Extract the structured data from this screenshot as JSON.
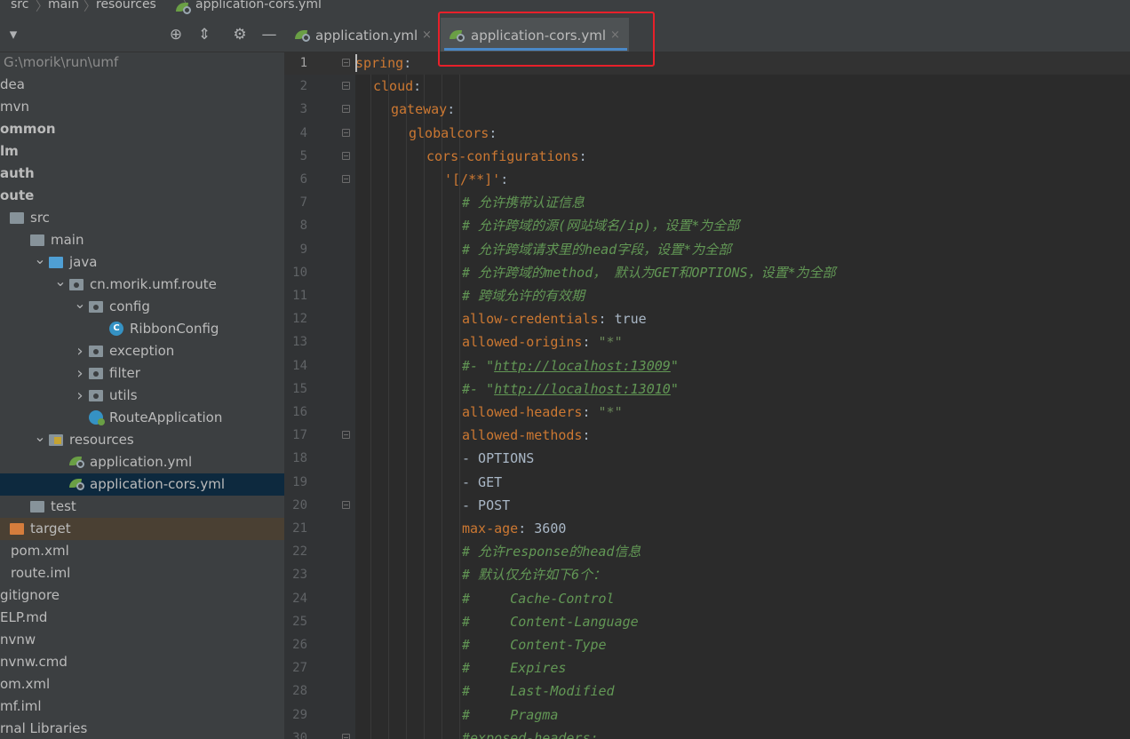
{
  "breadcrumb": [
    "src",
    "main",
    "resources",
    "application-cors.yml"
  ],
  "sidebar": {
    "toolbar": [
      "dropdown-icon",
      "locate-icon",
      "collapse-icon",
      "gear-icon",
      "minimize-icon"
    ],
    "tree": [
      {
        "label": "G:\\morik\\run\\umf",
        "indent": 4,
        "icon": "none",
        "arrow": "none",
        "style": "path"
      },
      {
        "label": "dea",
        "indent": 0,
        "icon": "none",
        "arrow": "none"
      },
      {
        "label": "mvn",
        "indent": 0,
        "icon": "none",
        "arrow": "none"
      },
      {
        "label": "ommon",
        "indent": 0,
        "icon": "none",
        "arrow": "none",
        "bold": true
      },
      {
        "label": "lm",
        "indent": 0,
        "icon": "none",
        "arrow": "none",
        "bold": true
      },
      {
        "label": "auth",
        "indent": 0,
        "icon": "none",
        "arrow": "none",
        "bold": true
      },
      {
        "label": "oute",
        "indent": 0,
        "icon": "none",
        "arrow": "none",
        "bold": true
      },
      {
        "label": "src",
        "indent": 12,
        "icon": "folder",
        "arrow": "none"
      },
      {
        "label": "main",
        "indent": 35,
        "icon": "folder",
        "arrow": "none"
      },
      {
        "label": "java",
        "indent": 56,
        "icon": "folder-blue",
        "arrow": "down"
      },
      {
        "label": "cn.morik.umf.route",
        "indent": 79,
        "icon": "folder-pkg",
        "arrow": "down"
      },
      {
        "label": "config",
        "indent": 101,
        "icon": "folder-pkg",
        "arrow": "down"
      },
      {
        "label": "RibbonConfig",
        "indent": 124,
        "icon": "class-c",
        "arrow": "none"
      },
      {
        "label": "exception",
        "indent": 101,
        "icon": "folder-pkg",
        "arrow": "right"
      },
      {
        "label": "filter",
        "indent": 101,
        "icon": "folder-pkg",
        "arrow": "right"
      },
      {
        "label": "utils",
        "indent": 101,
        "icon": "folder-pkg",
        "arrow": "right"
      },
      {
        "label": "RouteApplication",
        "indent": 101,
        "icon": "app-run",
        "arrow": "none"
      },
      {
        "label": "resources",
        "indent": 56,
        "icon": "folder-res",
        "arrow": "down"
      },
      {
        "label": "application.yml",
        "indent": 79,
        "icon": "spring",
        "arrow": "none"
      },
      {
        "label": "application-cors.yml",
        "indent": 79,
        "icon": "spring",
        "arrow": "none",
        "selected": true
      },
      {
        "label": "test",
        "indent": 35,
        "icon": "folder",
        "arrow": "none"
      },
      {
        "label": "target",
        "indent": 12,
        "icon": "folder-orange",
        "arrow": "none",
        "target": true
      },
      {
        "label": "pom.xml",
        "indent": 12,
        "icon": "none",
        "arrow": "none"
      },
      {
        "label": "route.iml",
        "indent": 12,
        "icon": "none",
        "arrow": "none"
      },
      {
        "label": "gitignore",
        "indent": 0,
        "icon": "none",
        "arrow": "none"
      },
      {
        "label": "ELP.md",
        "indent": 0,
        "icon": "none",
        "arrow": "none"
      },
      {
        "label": "nvnw",
        "indent": 0,
        "icon": "none",
        "arrow": "none"
      },
      {
        "label": "nvnw.cmd",
        "indent": 0,
        "icon": "none",
        "arrow": "none"
      },
      {
        "label": "om.xml",
        "indent": 0,
        "icon": "none",
        "arrow": "none"
      },
      {
        "label": "mf.iml",
        "indent": 0,
        "icon": "none",
        "arrow": "none"
      },
      {
        "label": "rnal Libraries",
        "indent": 0,
        "icon": "none",
        "arrow": "none"
      }
    ]
  },
  "tabs": [
    {
      "label": "application.yml",
      "close": "×",
      "active": false
    },
    {
      "label": "application-cors.yml",
      "close": "×",
      "active": true
    }
  ],
  "editor": {
    "lines": [
      {
        "n": "1",
        "indent": 0,
        "fold": true,
        "tokens": [
          [
            "k",
            "spring"
          ],
          [
            "p",
            ":"
          ]
        ]
      },
      {
        "n": "2",
        "indent": 1,
        "fold": true,
        "tokens": [
          [
            "k",
            "cloud"
          ],
          [
            "p",
            ":"
          ]
        ]
      },
      {
        "n": "3",
        "indent": 2,
        "fold": true,
        "tokens": [
          [
            "k",
            "gateway"
          ],
          [
            "p",
            ":"
          ]
        ]
      },
      {
        "n": "4",
        "indent": 3,
        "fold": true,
        "tokens": [
          [
            "k",
            "globalcors"
          ],
          [
            "p",
            ":"
          ]
        ]
      },
      {
        "n": "5",
        "indent": 4,
        "fold": true,
        "tokens": [
          [
            "k",
            "cors-configurations"
          ],
          [
            "p",
            ":"
          ]
        ]
      },
      {
        "n": "6",
        "indent": 5,
        "fold": true,
        "tokens": [
          [
            "k",
            "'[/**]'"
          ],
          [
            "p",
            ":"
          ]
        ]
      },
      {
        "n": "7",
        "indent": 6,
        "fold": false,
        "tokens": [
          [
            "c",
            "# 允许携带认证信息"
          ]
        ]
      },
      {
        "n": "8",
        "indent": 6,
        "fold": false,
        "tokens": [
          [
            "c",
            "# 允许跨域的源(网站域名/ip)，设置*为全部"
          ]
        ]
      },
      {
        "n": "9",
        "indent": 6,
        "fold": false,
        "tokens": [
          [
            "c",
            "# 允许跨域请求里的head字段，设置*为全部"
          ]
        ]
      },
      {
        "n": "10",
        "indent": 6,
        "fold": false,
        "tokens": [
          [
            "c",
            "# 允许跨域的method， 默认为GET和OPTIONS，设置*为全部"
          ]
        ]
      },
      {
        "n": "11",
        "indent": 6,
        "fold": false,
        "tokens": [
          [
            "c",
            "# 跨域允许的有效期"
          ]
        ]
      },
      {
        "n": "12",
        "indent": 6,
        "fold": false,
        "tokens": [
          [
            "k",
            "allow-credentials"
          ],
          [
            "p",
            ": true"
          ]
        ]
      },
      {
        "n": "13",
        "indent": 6,
        "fold": false,
        "tokens": [
          [
            "k",
            "allowed-origins"
          ],
          [
            "p",
            ": "
          ],
          [
            "s",
            "\"*\""
          ]
        ]
      },
      {
        "n": "14",
        "indent": 6,
        "fold": false,
        "tokens": [
          [
            "c",
            "#- \""
          ],
          [
            "cu",
            "http://localhost:13009"
          ],
          [
            "c",
            "\""
          ]
        ]
      },
      {
        "n": "15",
        "indent": 6,
        "fold": false,
        "tokens": [
          [
            "c",
            "#- \""
          ],
          [
            "cu",
            "http://localhost:13010"
          ],
          [
            "c",
            "\""
          ]
        ]
      },
      {
        "n": "16",
        "indent": 6,
        "fold": false,
        "tokens": [
          [
            "k",
            "allowed-headers"
          ],
          [
            "p",
            ": "
          ],
          [
            "s",
            "\"*\""
          ]
        ]
      },
      {
        "n": "17",
        "indent": 6,
        "fold": true,
        "tokens": [
          [
            "k",
            "allowed-methods"
          ],
          [
            "p",
            ":"
          ]
        ]
      },
      {
        "n": "18",
        "indent": 6,
        "fold": false,
        "tokens": [
          [
            "p",
            "- OPTIONS"
          ]
        ]
      },
      {
        "n": "19",
        "indent": 6,
        "fold": false,
        "tokens": [
          [
            "p",
            "- GET"
          ]
        ]
      },
      {
        "n": "20",
        "indent": 6,
        "fold": true,
        "tokens": [
          [
            "p",
            "- POST"
          ]
        ]
      },
      {
        "n": "21",
        "indent": 6,
        "fold": false,
        "tokens": [
          [
            "k",
            "max-age"
          ],
          [
            "p",
            ": 3600"
          ]
        ]
      },
      {
        "n": "22",
        "indent": 6,
        "fold": false,
        "tokens": [
          [
            "c",
            "# 允许response的head信息"
          ]
        ]
      },
      {
        "n": "23",
        "indent": 6,
        "fold": false,
        "tokens": [
          [
            "c",
            "# 默认仅允许如下6个："
          ]
        ]
      },
      {
        "n": "24",
        "indent": 6,
        "fold": false,
        "tokens": [
          [
            "c",
            "#     Cache-Control"
          ]
        ]
      },
      {
        "n": "25",
        "indent": 6,
        "fold": false,
        "tokens": [
          [
            "c",
            "#     Content-Language"
          ]
        ]
      },
      {
        "n": "26",
        "indent": 6,
        "fold": false,
        "tokens": [
          [
            "c",
            "#     Content-Type"
          ]
        ]
      },
      {
        "n": "27",
        "indent": 6,
        "fold": false,
        "tokens": [
          [
            "c",
            "#     Expires"
          ]
        ]
      },
      {
        "n": "28",
        "indent": 6,
        "fold": false,
        "tokens": [
          [
            "c",
            "#     Last-Modified"
          ]
        ]
      },
      {
        "n": "29",
        "indent": 6,
        "fold": false,
        "tokens": [
          [
            "c",
            "#     Pragma"
          ]
        ]
      },
      {
        "n": "30",
        "indent": 6,
        "fold": true,
        "tokens": [
          [
            "c",
            "#exposed-headers:"
          ]
        ]
      }
    ]
  },
  "colors": {
    "keyword": "#cc7832",
    "comment": "#629755",
    "string": "#6a8759",
    "text": "#a9b7c6",
    "selection": "#0d293e",
    "highlight_box": "#e8202a"
  }
}
